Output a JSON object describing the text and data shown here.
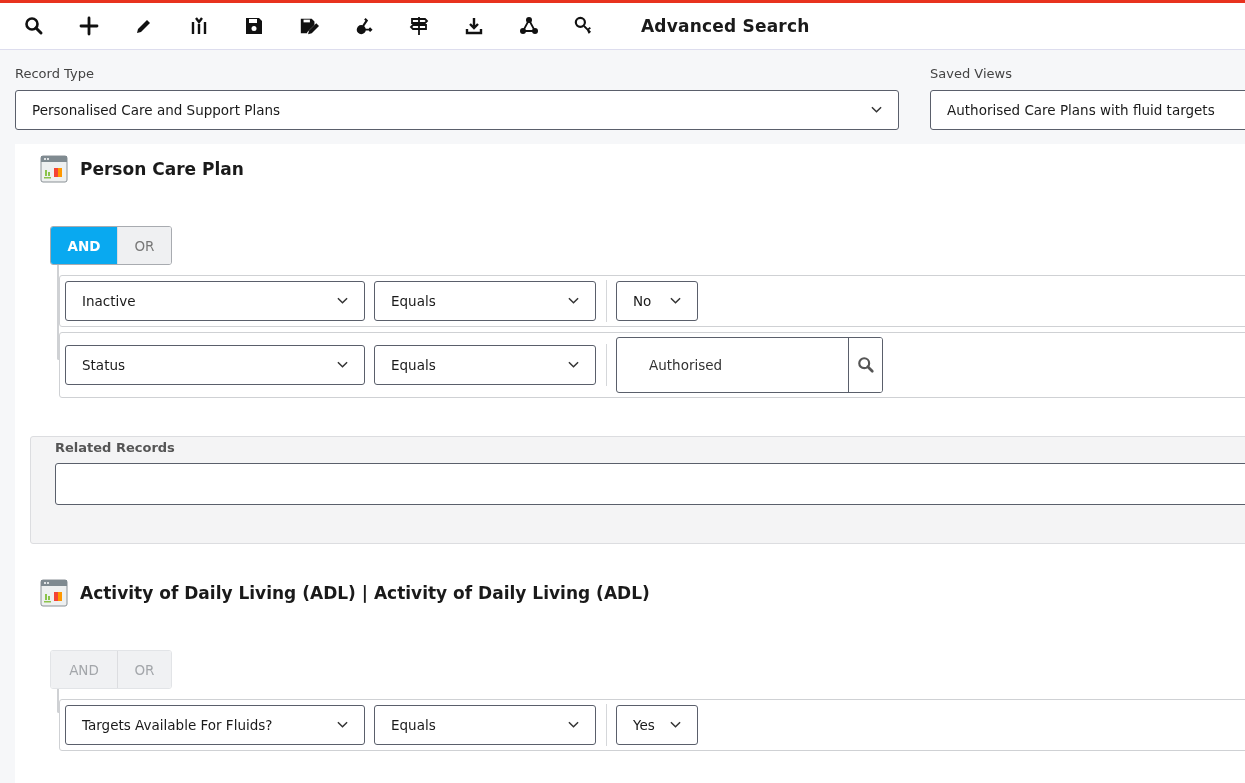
{
  "toolbar": {
    "title": "Advanced Search"
  },
  "record_type": {
    "label": "Record Type",
    "value": "Personalised Care and Support Plans"
  },
  "saved_views": {
    "label": "Saved Views",
    "value": "Authorised Care Plans with fluid targets"
  },
  "sections": [
    {
      "title": "Person Care Plan",
      "logic": {
        "disabled": false,
        "options": [
          {
            "label": "AND",
            "selected": true
          },
          {
            "label": "OR",
            "selected": false
          }
        ]
      },
      "conditions": [
        {
          "field": "Inactive",
          "operator": "Equals",
          "value": "No",
          "kind": "dropdown"
        },
        {
          "field": "Status",
          "operator": "Equals",
          "value": "Authorised",
          "kind": "lookup"
        }
      ],
      "related": {
        "label": "Related Records"
      }
    },
    {
      "title": "Activity of Daily Living (ADL) | Activity of Daily Living (ADL)",
      "logic": {
        "disabled": true,
        "options": [
          {
            "label": "AND",
            "selected": false
          },
          {
            "label": "OR",
            "selected": false
          }
        ]
      },
      "conditions": [
        {
          "field": "Targets Available For Fluids?",
          "operator": "Equals",
          "value": "Yes",
          "kind": "dropdown"
        }
      ]
    }
  ]
}
